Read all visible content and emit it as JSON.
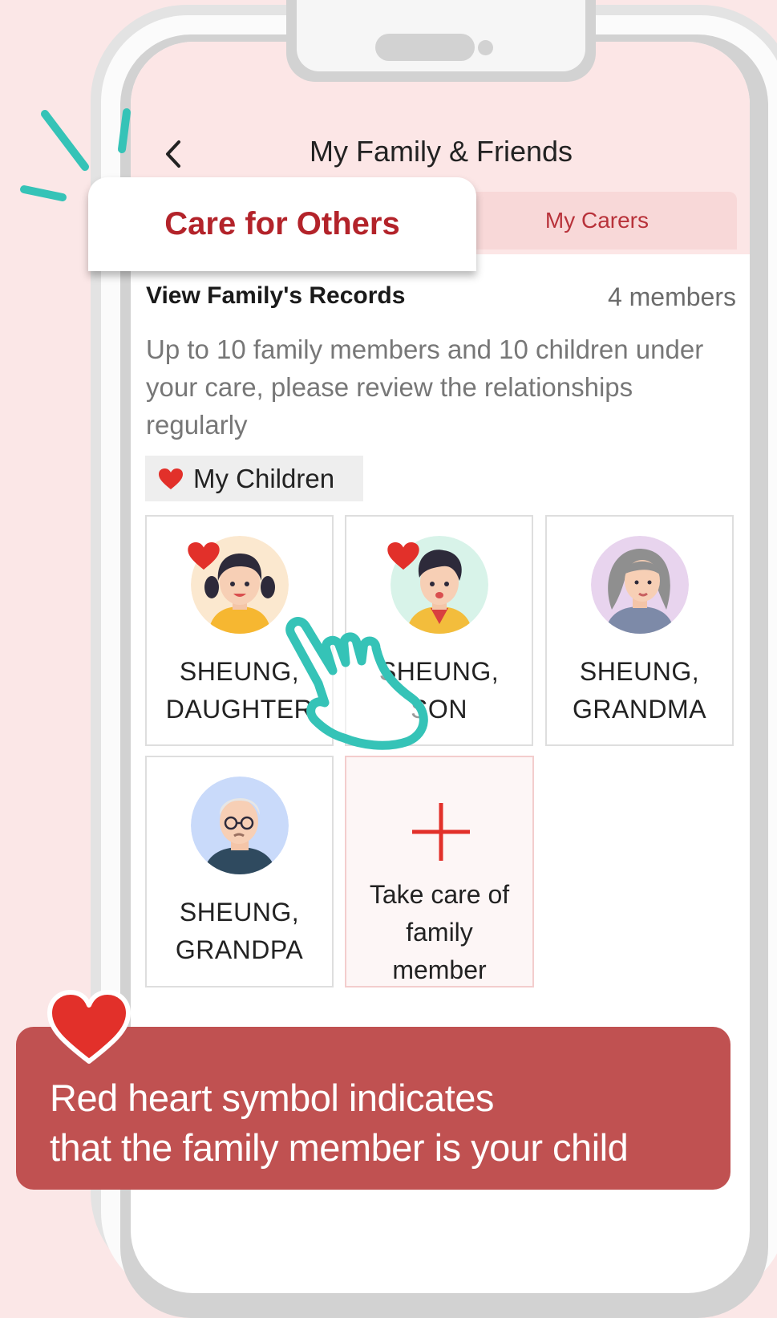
{
  "header": {
    "back_icon": "chevron-left-icon",
    "title": "My Family & Friends"
  },
  "tabs": [
    {
      "label": "Care for Others",
      "active": true
    },
    {
      "label": "My Carers",
      "active": false
    }
  ],
  "section": {
    "title": "View Family's Records",
    "count": "4 members",
    "description": "Up to 10 family members and 10 children under your care, please review the relationships regularly"
  },
  "filter_chip": {
    "label": "My Children",
    "icon": "heart-icon"
  },
  "members": [
    {
      "line1": "SHEUNG,",
      "line2": "DAUGHTER",
      "is_child": true
    },
    {
      "line1": "SHEUNG,",
      "line2": "SON",
      "is_child": true
    },
    {
      "line1": "SHEUNG,",
      "line2": "GRANDMA",
      "is_child": false
    },
    {
      "line1": "SHEUNG,",
      "line2": "GRANDPA",
      "is_child": false
    }
  ],
  "add_member": {
    "icon": "plus-icon",
    "line1": "Take care of",
    "line2": "family",
    "line3": "member"
  },
  "banner": {
    "line1": "Red heart symbol indicates",
    "line2": "that the family member is your child"
  },
  "colors": {
    "accent_red": "#b3232a",
    "heart_red": "#e2302a",
    "banner_bg": "#c05151",
    "page_bg": "#fbe7e7",
    "teal": "#35c3b7"
  }
}
